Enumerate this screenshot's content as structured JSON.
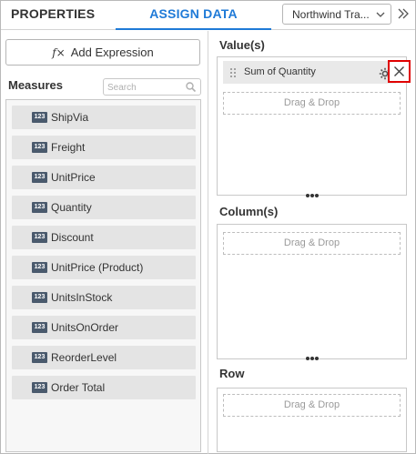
{
  "header": {
    "tabs": [
      {
        "label": "PROPERTIES",
        "active": false
      },
      {
        "label": "ASSIGN DATA",
        "active": true
      }
    ],
    "datasource": {
      "selected": "Northwind Tra..."
    },
    "accent_color": "#1f7ad7"
  },
  "left": {
    "add_expression_label": "Add Expression",
    "measures_label": "Measures",
    "search_placeholder": "Search",
    "badge_text": "123",
    "measures": [
      {
        "label": "ShipVia"
      },
      {
        "label": "Freight"
      },
      {
        "label": "UnitPrice"
      },
      {
        "label": "Quantity"
      },
      {
        "label": "Discount"
      },
      {
        "label": "UnitPrice (Product)"
      },
      {
        "label": "UnitsInStock"
      },
      {
        "label": "UnitsOnOrder"
      },
      {
        "label": "ReorderLevel"
      },
      {
        "label": "Order Total"
      }
    ]
  },
  "right": {
    "sections": [
      {
        "title": "Value(s)",
        "items": [
          "Sum of Quantity"
        ],
        "drop_label": "Drag & Drop"
      },
      {
        "title": "Column(s)",
        "items": [],
        "drop_label": "Drag & Drop"
      },
      {
        "title": "Row",
        "items": [],
        "drop_label": "Drag & Drop"
      }
    ],
    "highlight_color": "#e00000"
  }
}
